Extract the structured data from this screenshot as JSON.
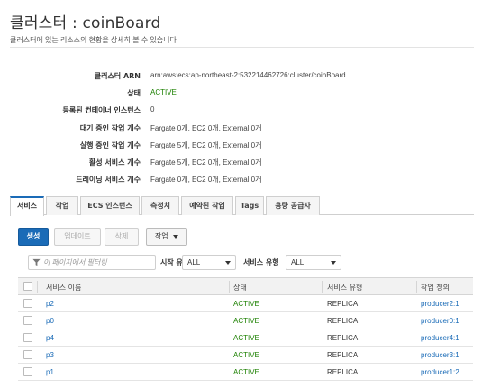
{
  "header": {
    "title": "클러스터 : coinBoard",
    "description": "클러스터에 있는 리소스의 현황을 상세히 볼 수 있습니다"
  },
  "details": [
    {
      "label": "클러스터 ARN",
      "value": "arn:aws:ecs:ap-northeast-2:532214462726:cluster/coinBoard",
      "kind": "plain"
    },
    {
      "label": "상태",
      "value": "ACTIVE",
      "kind": "active"
    },
    {
      "label": "등록된 컨테이너 인스턴스",
      "value": "0",
      "kind": "plain"
    },
    {
      "label": "대기 중인 작업 개수",
      "value": "Fargate 0개, EC2 0개, External 0개",
      "kind": "plain"
    },
    {
      "label": "실행 중인 작업 개수",
      "value": "Fargate 5개, EC2 0개, External 0개",
      "kind": "plain"
    },
    {
      "label": "활성 서비스 개수",
      "value": "Fargate 5개, EC2 0개, External 0개",
      "kind": "plain"
    },
    {
      "label": "드레이닝 서비스 개수",
      "value": "Fargate 0개, EC2 0개, External 0개",
      "kind": "plain"
    }
  ],
  "tabs": [
    {
      "label": "서비스",
      "active": true
    },
    {
      "label": "작업",
      "active": false
    },
    {
      "label": "ECS 인스턴스",
      "active": false
    },
    {
      "label": "측정치",
      "active": false
    },
    {
      "label": "예약된 작업",
      "active": false
    },
    {
      "label": "Tags",
      "active": false
    },
    {
      "label": "용량 공급자",
      "active": false
    }
  ],
  "buttons": {
    "create": "생성",
    "update": "업데이트",
    "delete": "삭제",
    "actions": "작업"
  },
  "filters": {
    "search_placeholder": "이 페이지에서 필터링",
    "launch_type_label": "시작 유형",
    "launch_type_value": "ALL",
    "service_type_label": "서비스 유형",
    "service_type_value": "ALL"
  },
  "table": {
    "columns": [
      "서비스 이름",
      "상태",
      "서비스 유형",
      "작업 정의"
    ],
    "rows": [
      {
        "name": "p2",
        "status": "ACTIVE",
        "type": "REPLICA",
        "taskdef": "producer2:1"
      },
      {
        "name": "p0",
        "status": "ACTIVE",
        "type": "REPLICA",
        "taskdef": "producer0:1"
      },
      {
        "name": "p4",
        "status": "ACTIVE",
        "type": "REPLICA",
        "taskdef": "producer4:1"
      },
      {
        "name": "p3",
        "status": "ACTIVE",
        "type": "REPLICA",
        "taskdef": "producer3:1"
      },
      {
        "name": "p1",
        "status": "ACTIVE",
        "type": "REPLICA",
        "taskdef": "producer1:2"
      }
    ]
  },
  "colors": {
    "accent": "#1a6bb7",
    "active_status": "#1d8102"
  }
}
